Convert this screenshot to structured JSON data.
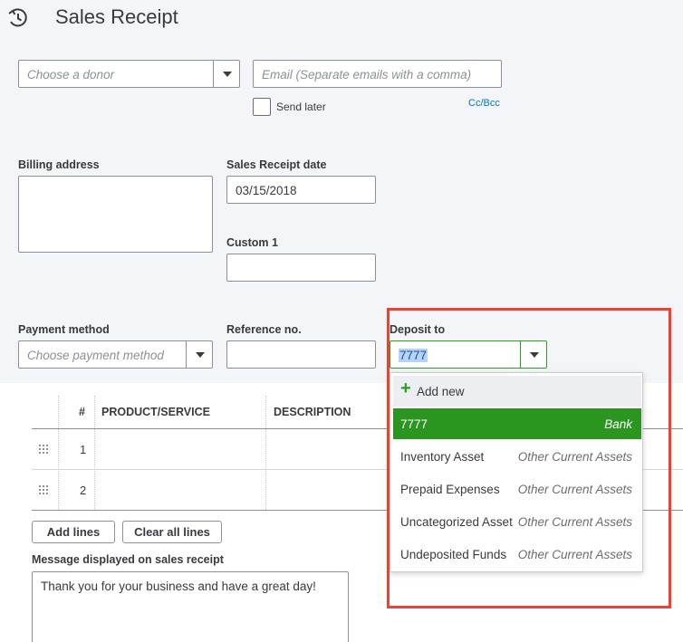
{
  "header": {
    "title": "Sales Receipt",
    "history_icon": "history-clock-icon"
  },
  "customer": {
    "placeholder": "Choose a donor"
  },
  "email": {
    "placeholder": "Email (Separate emails with a comma)",
    "send_later_label": "Send later",
    "cc_bcc_link": "Cc/Bcc"
  },
  "billing": {
    "label": "Billing address"
  },
  "receipt_date": {
    "label": "Sales Receipt date",
    "value": "03/15/2018"
  },
  "custom1": {
    "label": "Custom 1",
    "value": ""
  },
  "payment_method": {
    "label": "Payment method",
    "placeholder": "Choose payment method"
  },
  "reference": {
    "label": "Reference no.",
    "value": ""
  },
  "deposit_to": {
    "label": "Deposit to",
    "value": "7777",
    "add_new_label": "Add new",
    "options": [
      {
        "name": "7777",
        "type": "Bank",
        "selected": true
      },
      {
        "name": "Inventory Asset",
        "type": "Other Current Assets",
        "selected": false
      },
      {
        "name": "Prepaid Expenses",
        "type": "Other Current Assets",
        "selected": false
      },
      {
        "name": "Uncategorized Asset",
        "type": "Other Current Assets",
        "selected": false
      },
      {
        "name": "Undeposited Funds",
        "type": "Other Current Assets",
        "selected": false
      }
    ]
  },
  "lines_table": {
    "headers": [
      "#",
      "PRODUCT/SERVICE",
      "DESCRIPTION"
    ],
    "rows": [
      {
        "num": "1"
      },
      {
        "num": "2"
      }
    ]
  },
  "buttons": {
    "add_lines": "Add lines",
    "clear_all_lines": "Clear all lines"
  },
  "message": {
    "label": "Message displayed on sales receipt",
    "value": "Thank you for your business and have a great day!"
  },
  "colors": {
    "accent_green": "#2ca01c",
    "selected_row": "#2a9620",
    "link_blue": "#0077c5",
    "highlight_red": "#f0402f",
    "panel_bg": "#f4f5f8"
  }
}
